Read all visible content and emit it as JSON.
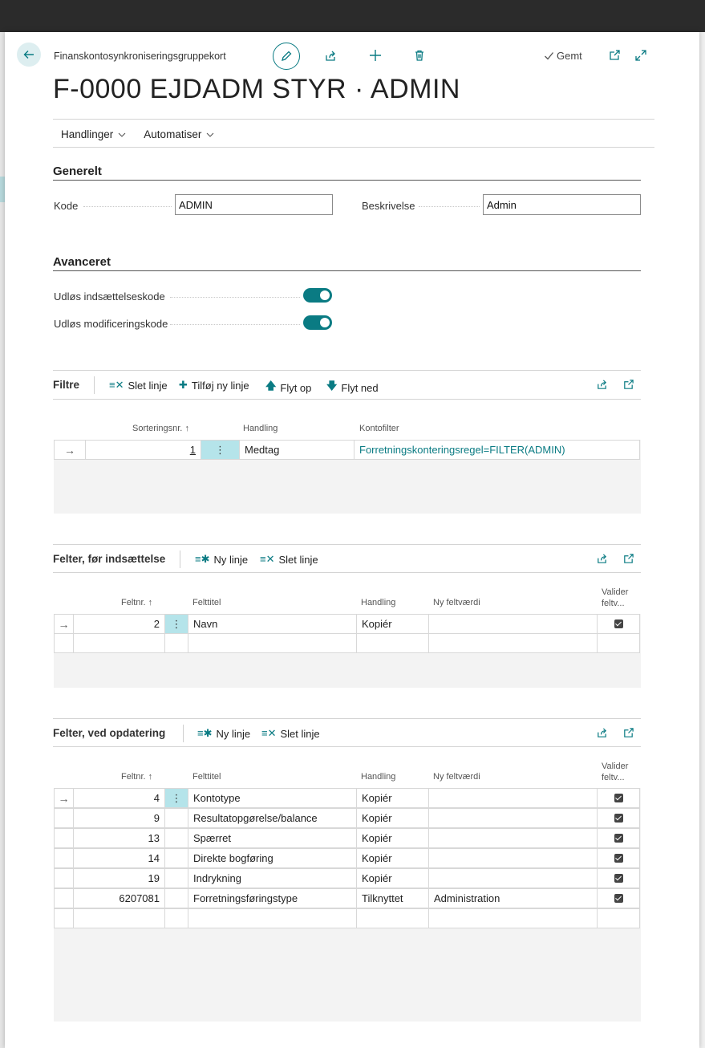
{
  "header": {
    "caption": "Finanskontosynkroniseringsgruppekort",
    "title": "F-0000 EJDADM STYR · ADMIN",
    "saved_label": "Gemt"
  },
  "actions": {
    "handlinger": "Handlinger",
    "automatiser": "Automatiser"
  },
  "general": {
    "title": "Generelt",
    "kode_label": "Kode",
    "kode_value": "ADMIN",
    "beskrivelse_label": "Beskrivelse",
    "beskrivelse_value": "Admin"
  },
  "advanced": {
    "title": "Avanceret",
    "insert_label": "Udløs indsættelseskode",
    "insert_on": true,
    "modify_label": "Udløs modificeringskode",
    "modify_on": true
  },
  "filters": {
    "title": "Filtre",
    "tools": {
      "delete": "Slet linje",
      "add": "Tilføj ny linje",
      "up": "Flyt op",
      "down": "Flyt ned"
    },
    "columns": {
      "sort": "Sorteringsnr.",
      "action": "Handling",
      "filter": "Kontofilter"
    },
    "rows": [
      {
        "sort": "1",
        "action": "Medtag",
        "filter": "Forretningskonteringsregel=FILTER(ADMIN)"
      }
    ]
  },
  "before_insert": {
    "title": "Felter, før indsættelse",
    "tools": {
      "new": "Ny linje",
      "delete": "Slet linje"
    },
    "columns": {
      "field_no": "Feltnr.",
      "field_title": "Felttitel",
      "action": "Handling",
      "new_value": "Ny feltværdi",
      "validate_1": "Valider",
      "validate_2": "feltv..."
    },
    "rows": [
      {
        "field_no": "2",
        "field_title": "Navn",
        "action": "Kopiér",
        "new_value": "",
        "validate": true
      }
    ]
  },
  "on_update": {
    "title": "Felter, ved opdatering",
    "tools": {
      "new": "Ny linje",
      "delete": "Slet linje"
    },
    "columns": {
      "field_no": "Feltnr.",
      "field_title": "Felttitel",
      "action": "Handling",
      "new_value": "Ny feltværdi",
      "validate_1": "Valider",
      "validate_2": "feltv..."
    },
    "rows": [
      {
        "field_no": "4",
        "field_title": "Kontotype",
        "action": "Kopiér",
        "new_value": "",
        "validate": true
      },
      {
        "field_no": "9",
        "field_title": "Resultatopgørelse/balance",
        "action": "Kopiér",
        "new_value": "",
        "validate": true
      },
      {
        "field_no": "13",
        "field_title": "Spærret",
        "action": "Kopiér",
        "new_value": "",
        "validate": true
      },
      {
        "field_no": "14",
        "field_title": "Direkte bogføring",
        "action": "Kopiér",
        "new_value": "",
        "validate": true
      },
      {
        "field_no": "19",
        "field_title": "Indrykning",
        "action": "Kopiér",
        "new_value": "",
        "validate": true
      },
      {
        "field_no": "6207081",
        "field_title": "Forretningsføringstype",
        "action": "Tilknyttet",
        "new_value": "Administration",
        "validate": true
      }
    ]
  },
  "colors": {
    "accent": "#0a7b83",
    "selected_cell": "#b5e4ea"
  }
}
